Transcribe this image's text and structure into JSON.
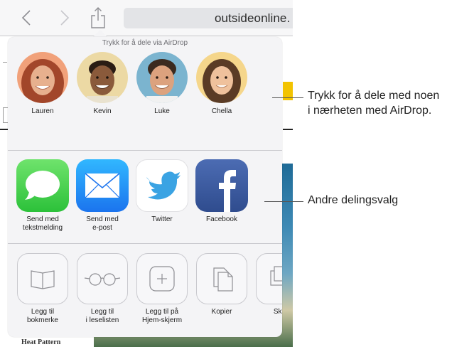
{
  "browser": {
    "url": "outsideonline.",
    "footer_text": "Heat Pattern"
  },
  "share_sheet": {
    "airdrop_title": "Trykk for å dele via AirDrop",
    "contacts": [
      {
        "name": "Lauren",
        "skin": "#e7b08e",
        "hair": "#a2462a",
        "bg": "#f1a17a"
      },
      {
        "name": "Kevin",
        "skin": "#8a5a3b",
        "hair": "#2a1c14",
        "bg": "#ecd9a4"
      },
      {
        "name": "Luke",
        "skin": "#dca27e",
        "hair": "#3b2a1f",
        "bg": "#7bb4cf"
      },
      {
        "name": "Chella",
        "skin": "#efc19c",
        "hair": "#5a3b25",
        "bg": "#f5d68b"
      }
    ],
    "apps": [
      {
        "label": "Send med\ntekstmelding",
        "icon": "messages-icon",
        "color": "#4cd964"
      },
      {
        "label": "Send med\ne-post",
        "icon": "mail-icon",
        "color": "#1e8dfa"
      },
      {
        "label": "Twitter",
        "icon": "twitter-icon",
        "color": "#ffffff"
      },
      {
        "label": "Facebook",
        "icon": "facebook-icon",
        "color": "#3b5998"
      }
    ],
    "actions": [
      {
        "label": "Legg til\nbokmerke",
        "icon": "book-icon"
      },
      {
        "label": "Legg til\ni leselisten",
        "icon": "glasses-icon"
      },
      {
        "label": "Legg til på\nHjem-skjerm",
        "icon": "add-square-icon"
      },
      {
        "label": "Kopier",
        "icon": "copy-icon"
      },
      {
        "label": "Skriv",
        "icon": "print-icon"
      }
    ]
  },
  "callouts": {
    "airdrop": "Trykk for å dele med noen\ni nærheten med AirDrop.",
    "sharing": "Andre delingsvalg"
  }
}
